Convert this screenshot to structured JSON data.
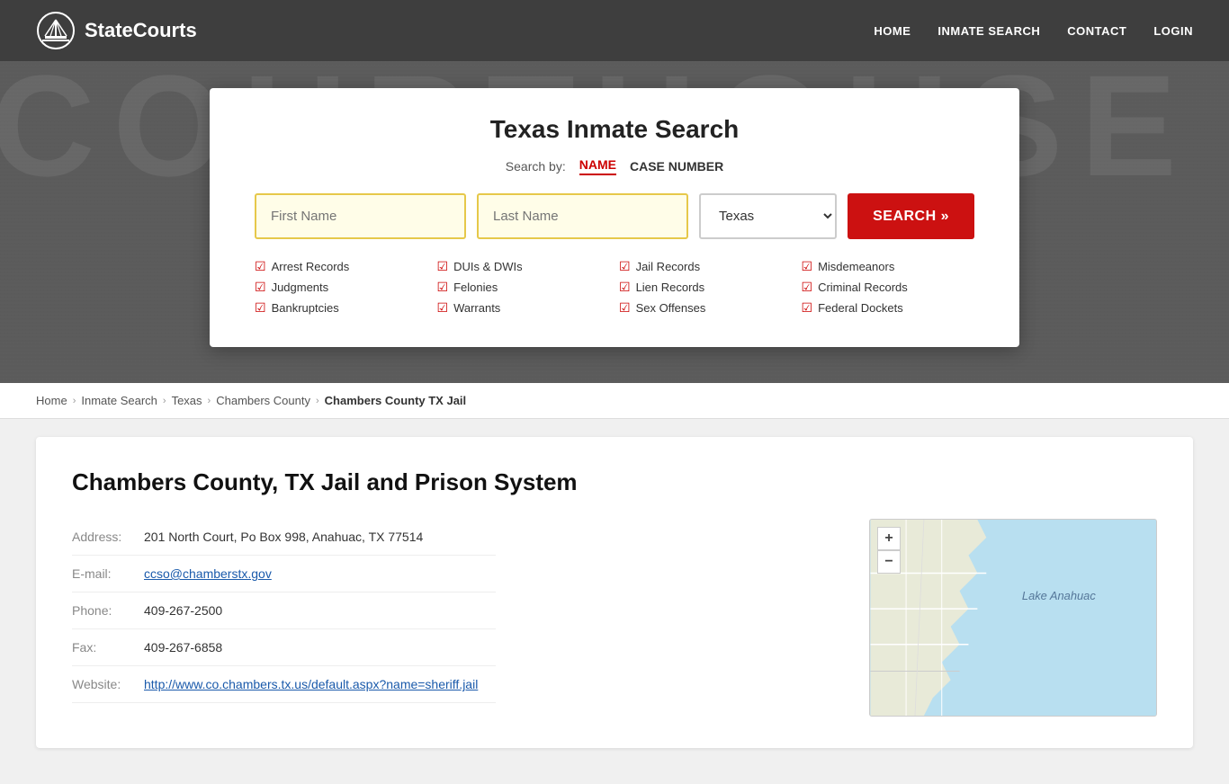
{
  "header": {
    "logo_text": "StateCourts",
    "nav": [
      {
        "label": "HOME",
        "href": "#"
      },
      {
        "label": "INMATE SEARCH",
        "href": "#"
      },
      {
        "label": "CONTACT",
        "href": "#"
      },
      {
        "label": "LOGIN",
        "href": "#"
      }
    ]
  },
  "hero_bg_text": "COURTHOUSE",
  "search_card": {
    "title": "Texas Inmate Search",
    "search_by_label": "Search by:",
    "tab_name": "NAME",
    "tab_case": "CASE NUMBER",
    "first_name_placeholder": "First Name",
    "last_name_placeholder": "Last Name",
    "state_value": "Texas",
    "search_button": "SEARCH »",
    "checks": [
      "Arrest Records",
      "Judgments",
      "Bankruptcies",
      "DUIs & DWIs",
      "Felonies",
      "Warrants",
      "Jail Records",
      "Lien Records",
      "Sex Offenses",
      "Misdemeanors",
      "Criminal Records",
      "Federal Dockets"
    ]
  },
  "breadcrumb": {
    "items": [
      {
        "label": "Home",
        "href": "#"
      },
      {
        "label": "Inmate Search",
        "href": "#"
      },
      {
        "label": "Texas",
        "href": "#"
      },
      {
        "label": "Chambers County",
        "href": "#"
      },
      {
        "label": "Chambers County TX Jail",
        "current": true
      }
    ]
  },
  "content": {
    "title": "Chambers County, TX Jail and Prison System",
    "address_label": "Address:",
    "address_value": "201 North Court, Po Box 998, Anahuac, TX 77514",
    "email_label": "E-mail:",
    "email_value": "ccso@chamberstx.gov",
    "phone_label": "Phone:",
    "phone_value": "409-267-2500",
    "fax_label": "Fax:",
    "fax_value": "409-267-6858",
    "website_label": "Website:",
    "website_value": "http://www.co.chambers.tx.us/default.aspx?name=sheriff.jail",
    "map_label": "Lake Anahuac"
  }
}
